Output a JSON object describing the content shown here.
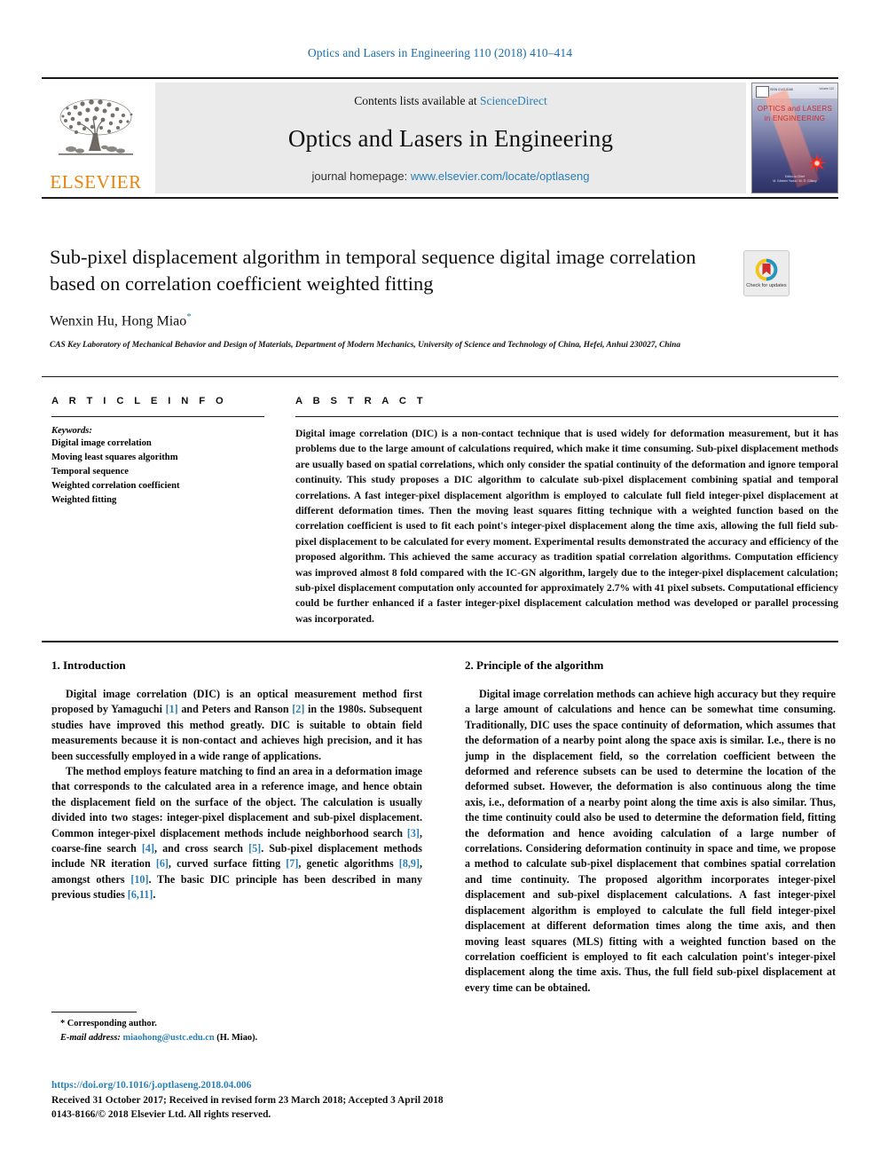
{
  "running_head": "Optics and Lasers in Engineering 110 (2018) 410–414",
  "masthead": {
    "publisher_logo_text": "ELSEVIER",
    "contents_prefix": "Contents lists available at ",
    "contents_link": "ScienceDirect",
    "journal_title": "Optics and Lasers in Engineering",
    "homepage_prefix": "journal homepage: ",
    "homepage_link": "www.elsevier.com/locate/optlaseng",
    "cover": {
      "title_line1": "OPTICS and LASERS",
      "title_line2": "in ENGINEERING",
      "mini_text": "ISSN 0143-8166",
      "issn_corner": "Volume 110",
      "foot_line1": "Editor-in-Chief",
      "foot_line2": "M. Görkem Yavuz / M. Ö. Gülsoy"
    }
  },
  "title_block": {
    "title": "Sub-pixel displacement algorithm in temporal sequence digital image correlation based on correlation coefficient weighted fitting",
    "authors": "Wenxin Hu, Hong Miao",
    "corresponding_marker": "*",
    "affiliation": "CAS Key Laboratory of Mechanical Behavior and Design of Materials, Department of Modern Mechanics, University of Science and Technology of China, Hefei, Anhui 230027, China",
    "crossmark_label": "Check for updates"
  },
  "article_info": {
    "heading": "A R T I C L E   I N F O",
    "keywords_label": "Keywords:",
    "keywords": [
      "Digital image correlation",
      "Moving least squares algorithm",
      "Temporal sequence",
      "Weighted correlation coefficient",
      "Weighted fitting"
    ]
  },
  "abstract": {
    "heading": "A B S T R A C T",
    "text": "Digital image correlation (DIC) is a non-contact technique that is used widely for deformation measurement, but it has problems due to the large amount of calculations required, which make it time consuming. Sub-pixel displacement methods are usually based on spatial correlations, which only consider the spatial continuity of the deformation and ignore temporal continuity. This study proposes a DIC algorithm to calculate sub-pixel displacement combining spatial and temporal correlations. A fast integer-pixel displacement algorithm is employed to calculate full field integer-pixel displacement at different deformation times. Then the moving least squares fitting technique with a weighted function based on the correlation coefficient is used to fit each point's integer-pixel displacement along the time axis, allowing the full field sub-pixel displacement to be calculated for every moment. Experimental results demonstrated the accuracy and efficiency of the proposed algorithm. This achieved the same accuracy as tradition spatial correlation algorithms. Computation efficiency was improved almost 8 fold compared with the IC-GN algorithm, largely due to the integer-pixel displacement calculation; sub-pixel displacement computation only accounted for approximately 2.7% with 41 pixel subsets. Computational efficiency could be further enhanced if a faster integer-pixel displacement calculation method was developed or parallel processing was incorporated."
  },
  "sections": {
    "left": {
      "heading": "1.  Introduction",
      "paragraphs": [
        "Digital image correlation (DIC) is an optical measurement method first proposed by Yamaguchi [1] and Peters and Ranson [2] in the 1980s. Subsequent studies have improved this method greatly. DIC is suitable to obtain field measurements because it is non-contact and achieves high precision, and it has been successfully employed in a wide range of applications.",
        "The method employs feature matching to find an area in a deformation image that corresponds to the calculated area in a reference image, and hence obtain the displacement field on the surface of the object. The calculation is usually divided into two stages: integer-pixel displacement and sub-pixel displacement. Common integer-pixel displacement methods include neighborhood search [3], coarse-fine search [4], and cross search [5]. Sub-pixel displacement methods include NR iteration [6], curved surface fitting [7], genetic algorithms [8,9], amongst others [10]. The basic DIC principle has been described in many previous studies [6,11]."
      ]
    },
    "right": {
      "heading": "2.  Principle of the algorithm",
      "paragraphs": [
        "Digital image correlation methods can achieve high accuracy but they require a large amount of calculations and hence can be somewhat time consuming. Traditionally, DIC uses the space continuity of deformation, which assumes that the deformation of a nearby point along the space axis is similar. I.e., there is no jump in the displacement field, so the correlation coefficient between the deformed and reference subsets can be used to determine the location of the deformed subset. However, the deformation is also continuous along the time axis, i.e., deformation of a nearby point along the time axis is also similar. Thus, the time continuity could also be used to determine the deformation field, fitting the deformation and hence avoiding calculation of a large number of correlations. Considering deformation continuity in space and time, we propose a method to calculate sub-pixel displacement that combines spatial correlation and time continuity. The proposed algorithm incorporates integer-pixel displacement and sub-pixel displacement calculations. A fast integer-pixel displacement algorithm is employed to calculate the full field integer-pixel displacement at different deformation times along the time axis, and then moving least squares (MLS) fitting with a weighted function based on the correlation coefficient is employed to fit each calculation point's integer-pixel displacement along the time axis. Thus, the full field sub-pixel displacement at every time can be obtained."
      ]
    }
  },
  "footnote": {
    "corresponding": "* Corresponding author.",
    "email_label": "E-mail address:",
    "email": "miaohong@ustc.edu.cn",
    "email_suffix": "(H. Miao)."
  },
  "footer": {
    "doi": "https://doi.org/10.1016/j.optlaseng.2018.04.006",
    "dates": "Received 31 October 2017; Received in revised form 23 March 2018; Accepted 3 April 2018",
    "copyright": "0143-8166/© 2018 Elsevier Ltd. All rights reserved."
  },
  "colors": {
    "link": "#2a7fb5",
    "elsevier_orange": "#e8820c",
    "running_head": "#1a6fa8",
    "band_gray": "#eaeaea"
  }
}
